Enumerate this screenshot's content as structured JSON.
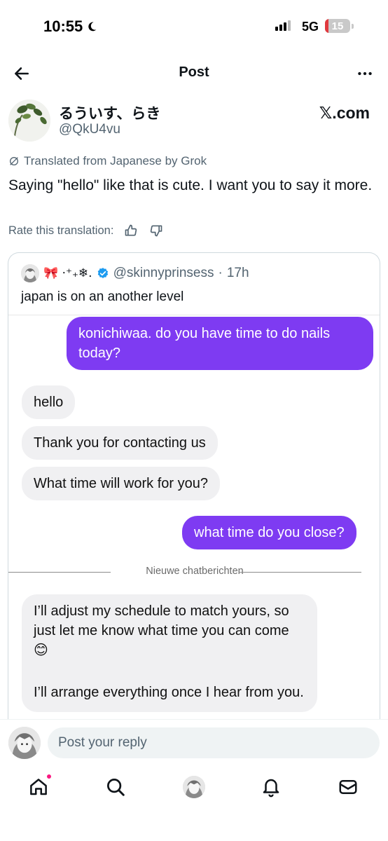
{
  "status_bar": {
    "time": "10:55",
    "network": "5G",
    "battery": "15",
    "battery_level": 0.15,
    "battery_color": "#e0393e",
    "icons": [
      "moon-icon",
      "signal-icon"
    ]
  },
  "nav": {
    "title": "Post",
    "icons": [
      "back-arrow-icon",
      "more-icon"
    ]
  },
  "post": {
    "author_name": "るういす、らき",
    "author_handle": "@QkU4vu",
    "source": "𝕏.com",
    "translation_note": "Translated from Japanese by Grok",
    "text": "Saying \"hello\" like that is cute. I want you to say it more.",
    "rate_label": "Rate this translation:",
    "rate_icons": [
      "thumbs-up-icon",
      "thumbs-down-icon"
    ]
  },
  "quote": {
    "name": "🎀 ⋅⁺₊❄︎.",
    "handle": "@skinnyprinsess",
    "separator": "·",
    "time": "17h",
    "text": "japan is on an another level",
    "verified_color": "#1d9bf0"
  },
  "chat": {
    "accent": "#7e3bf2",
    "messages": [
      {
        "direction": "out",
        "text": "konichiwaa. do you have time to do nails today?"
      },
      {
        "direction": "in",
        "text": "hello"
      },
      {
        "direction": "in",
        "text": "Thank you for contacting us"
      },
      {
        "direction": "in",
        "text": "What time will work for you?"
      },
      {
        "direction": "out",
        "text": "what time do you close?"
      }
    ],
    "divider_label": "Nieuwe chatberichten",
    "after_divider": {
      "direction": "in",
      "paragraph_1": "I’ll adjust my schedule to match yours, so just let me know what time you can come 😊",
      "paragraph_2": "I’ll arrange everything once I hear from you."
    }
  },
  "reply": {
    "placeholder": "Post your reply"
  },
  "tabbar": {
    "tabs": [
      "home-icon",
      "search-icon",
      "profile-avatar",
      "notifications-icon",
      "messages-icon"
    ],
    "notification_dot_color": "#f91880"
  }
}
